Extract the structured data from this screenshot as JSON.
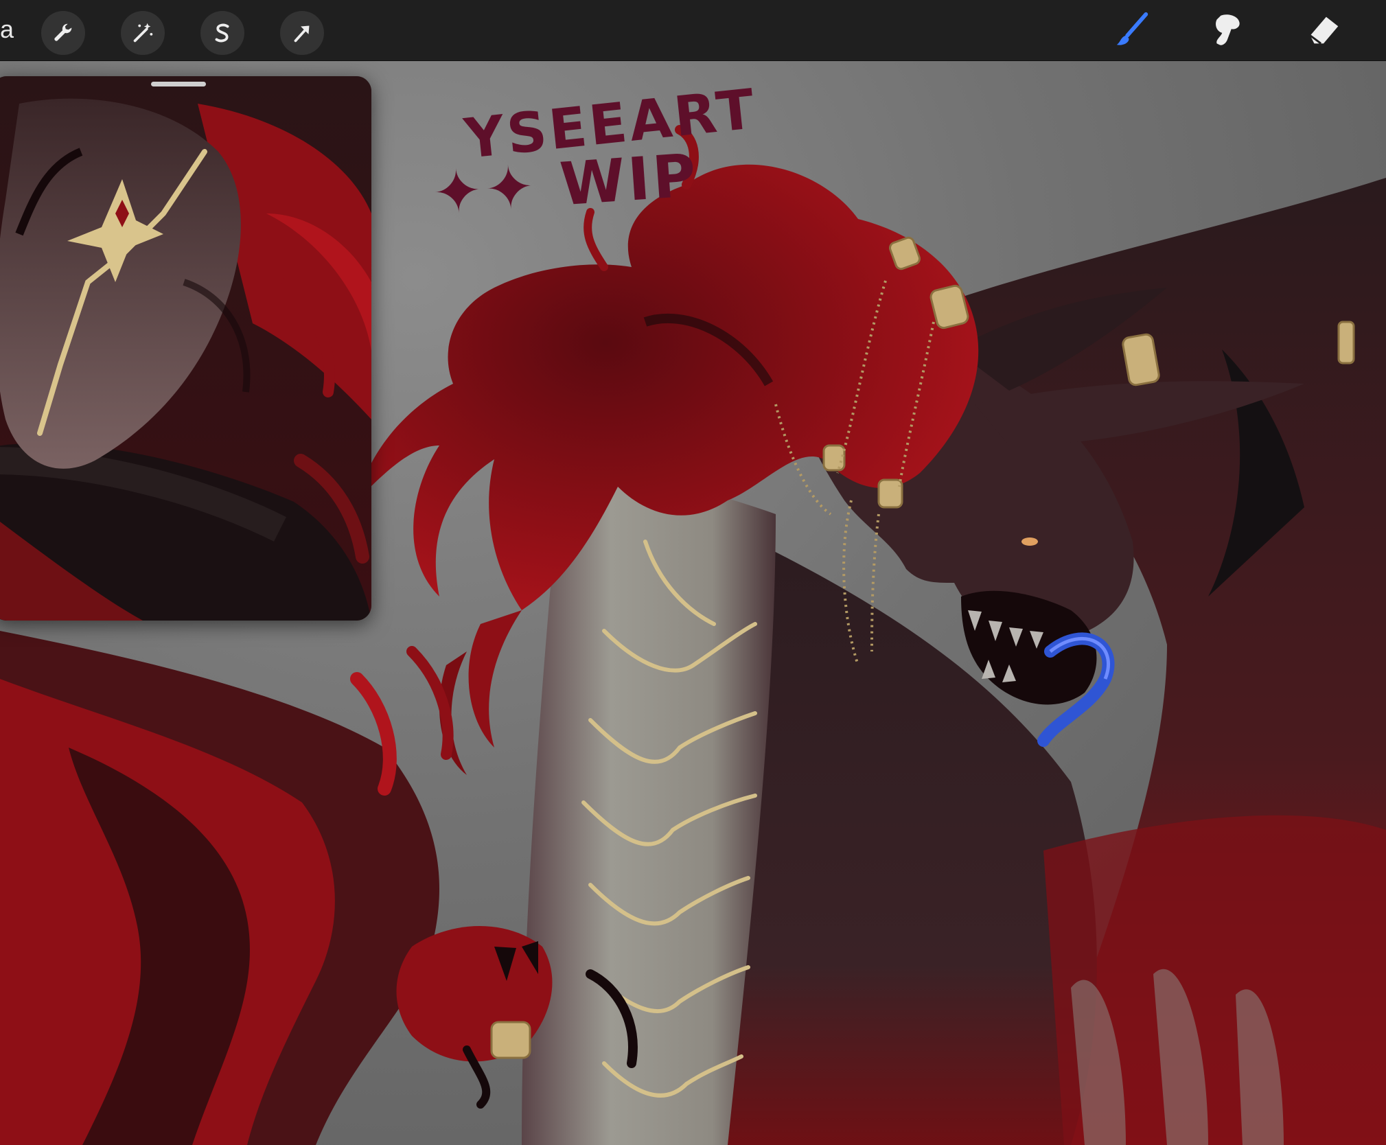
{
  "toolbar": {
    "gallery_label": "a",
    "left_tools": [
      {
        "id": "actions",
        "icon": "wrench-icon"
      },
      {
        "id": "adjustments",
        "icon": "magic-wand-icon"
      },
      {
        "id": "selection",
        "icon": "selection-s-icon"
      },
      {
        "id": "transform",
        "icon": "arrow-cursor-icon"
      }
    ],
    "right_tools": [
      {
        "id": "brush",
        "icon": "brush-icon",
        "active": true
      },
      {
        "id": "smudge",
        "icon": "smudge-icon",
        "active": false
      },
      {
        "id": "eraser",
        "icon": "eraser-icon",
        "active": false
      }
    ],
    "active_color": "#3a7bff"
  },
  "canvas": {
    "handwriting_line1": "YSEEART",
    "handwriting_line2": "✦✦ WIP",
    "ink_color": "#5e0f2a"
  },
  "reference_window": {
    "visible": true
  },
  "colors": {
    "toolbar_bg": "#1f1f1f",
    "canvas_gray": "#6b6b6b",
    "dragon_dark": "#2b1a1e",
    "dragon_red": "#8e0f16",
    "gold": "#c9b07a",
    "tongue_blue": "#2f55d4",
    "belly": "#9a9890"
  }
}
